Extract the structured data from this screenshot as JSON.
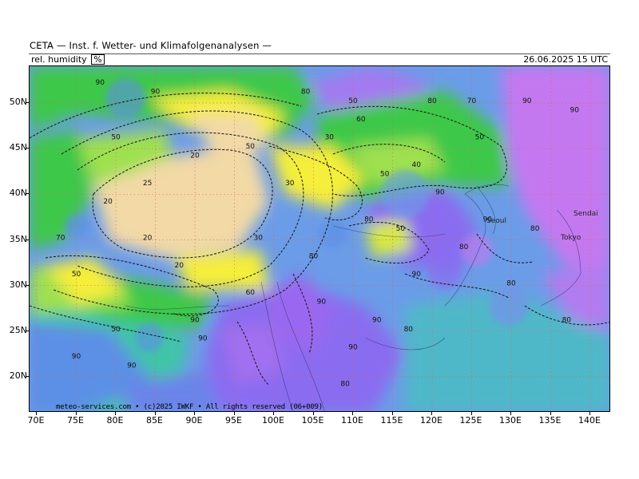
{
  "header": {
    "title": "CETA — Inst. f. Wetter- und Klimafolgenanalysen —",
    "variable": "rel. humidity",
    "unit": "%",
    "datetime": "26.06.2025 15 UTC"
  },
  "axes": {
    "lat_labels": [
      "50N",
      "45N",
      "40N",
      "35N",
      "30N",
      "25N",
      "20N"
    ],
    "lon_labels": [
      "70E",
      "75E",
      "80E",
      "85E",
      "90E",
      "95E",
      "100E",
      "105E",
      "110E",
      "115E",
      "120E",
      "125E",
      "130E",
      "135E",
      "140E"
    ]
  },
  "footer": {
    "credit": "meteo-services.com • (c)2025 IWKF • All rights reserved (06+009)"
  },
  "places": {
    "seoul": "Seoul",
    "sendai": "Sendai",
    "tokyo": "Tokyo"
  },
  "contour_labels": [
    {
      "lon": 79,
      "lat": 39,
      "text": "20"
    },
    {
      "lon": 84,
      "lat": 35,
      "text": "20"
    },
    {
      "lon": 90,
      "lat": 44,
      "text": "20"
    },
    {
      "lon": 84,
      "lat": 41,
      "text": "25"
    },
    {
      "lon": 88,
      "lat": 32,
      "text": "20"
    },
    {
      "lon": 98,
      "lat": 35,
      "text": "30"
    },
    {
      "lon": 102,
      "lat": 41,
      "text": "30"
    },
    {
      "lon": 107,
      "lat": 46,
      "text": "30"
    },
    {
      "lon": 80,
      "lat": 46,
      "text": "50"
    },
    {
      "lon": 97,
      "lat": 45,
      "text": "50"
    },
    {
      "lon": 114,
      "lat": 42,
      "text": "50"
    },
    {
      "lon": 75,
      "lat": 31,
      "text": "50"
    },
    {
      "lon": 80,
      "lat": 25,
      "text": "50"
    },
    {
      "lon": 97,
      "lat": 29,
      "text": "60"
    },
    {
      "lon": 110,
      "lat": 50,
      "text": "50"
    },
    {
      "lon": 118,
      "lat": 43,
      "text": "40"
    },
    {
      "lon": 126,
      "lat": 46,
      "text": "50"
    },
    {
      "lon": 111,
      "lat": 48,
      "text": "60"
    },
    {
      "lon": 120,
      "lat": 50,
      "text": "80"
    },
    {
      "lon": 78,
      "lat": 52,
      "text": "90"
    },
    {
      "lon": 85,
      "lat": 51,
      "text": "90"
    },
    {
      "lon": 104,
      "lat": 51,
      "text": "80"
    },
    {
      "lon": 132,
      "lat": 50,
      "text": "90"
    },
    {
      "lon": 138,
      "lat": 49,
      "text": "90"
    },
    {
      "lon": 121,
      "lat": 40,
      "text": "90"
    },
    {
      "lon": 127,
      "lat": 37,
      "text": "90"
    },
    {
      "lon": 133,
      "lat": 36,
      "text": "80"
    },
    {
      "lon": 118,
      "lat": 31,
      "text": "90"
    },
    {
      "lon": 106,
      "lat": 28,
      "text": "90"
    },
    {
      "lon": 113,
      "lat": 26,
      "text": "90"
    },
    {
      "lon": 117,
      "lat": 25,
      "text": "80"
    },
    {
      "lon": 110,
      "lat": 23,
      "text": "90"
    },
    {
      "lon": 109,
      "lat": 19,
      "text": "80"
    },
    {
      "lon": 91,
      "lat": 24,
      "text": "90"
    },
    {
      "lon": 82,
      "lat": 21,
      "text": "90"
    },
    {
      "lon": 75,
      "lat": 22,
      "text": "90"
    },
    {
      "lon": 130,
      "lat": 30,
      "text": "80"
    },
    {
      "lon": 137,
      "lat": 26,
      "text": "80"
    },
    {
      "lon": 112,
      "lat": 37,
      "text": "80"
    },
    {
      "lon": 105,
      "lat": 33,
      "text": "80"
    },
    {
      "lon": 90,
      "lat": 26,
      "text": "90"
    },
    {
      "lon": 124,
      "lat": 34,
      "text": "80"
    },
    {
      "lon": 116,
      "lat": 36,
      "text": "50"
    },
    {
      "lon": 73,
      "lat": 35,
      "text": "70"
    },
    {
      "lon": 125,
      "lat": 50,
      "text": "70"
    }
  ],
  "colors": {
    "background_sea": "#6b9ce8",
    "dry_tan": "#f2d9a6",
    "yellow": "#f5ee3a",
    "green_light": "#9fe04f",
    "green": "#3ec84a",
    "teal": "#35c8a0",
    "blue": "#5c8fe6",
    "purple": "#8a6cf0",
    "magenta": "#c478f0"
  }
}
